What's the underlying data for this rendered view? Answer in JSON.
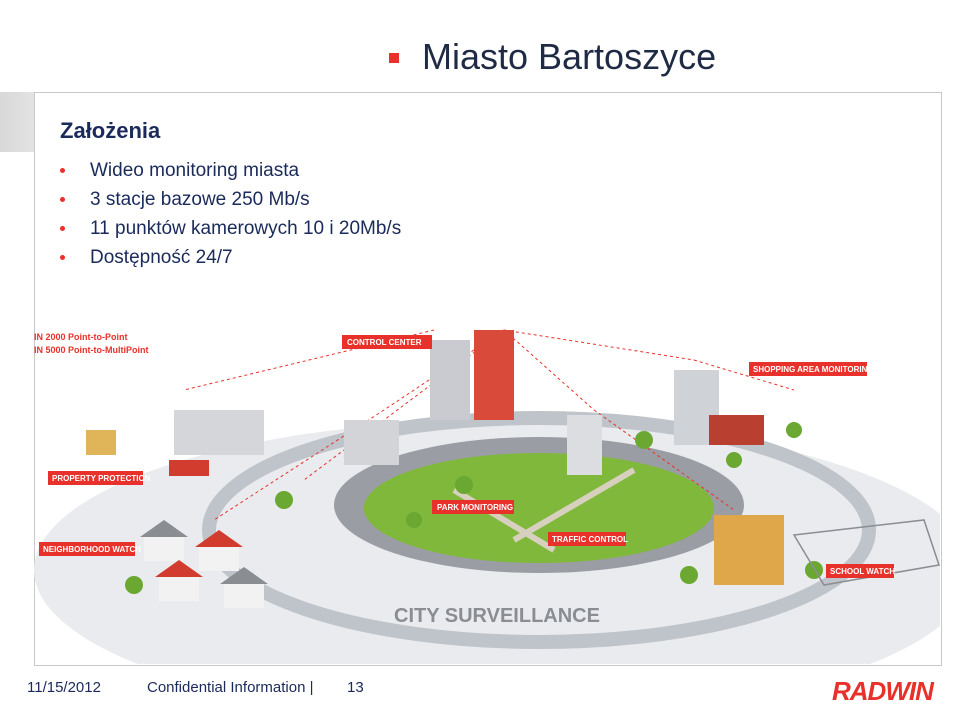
{
  "title": "Miasto Bartoszyce",
  "section": {
    "heading": "Założenia",
    "bullets": [
      "Wideo monitoring miasta",
      "3 stacje bazowe 250 Mb/s",
      "11 punktów kamerowych 10 i 20Mb/s",
      "Dostępność 24/7"
    ]
  },
  "illustration": {
    "legend": [
      "IN 2000 Point-to-Point",
      "IN 5000 Point-to-MultiPoint"
    ],
    "labels": {
      "control_center": "CONTROL CENTER",
      "shopping": "SHOPPING AREA MONITORING",
      "property": "PROPERTY PROTECTION",
      "park": "PARK MONITORING",
      "neighborhood": "NEIGHBORHOOD WATCH",
      "traffic": "TRAFFIC CONTROL",
      "school": "SCHOOL WATCH"
    },
    "caption": "CITY SURVEILLANCE"
  },
  "footer": {
    "date": "11/15/2012",
    "confidential": "Confidential Information  |",
    "page": "13",
    "brand": "RADWIN"
  },
  "colors": {
    "accent": "#e8312a",
    "text": "#1a2a5a"
  }
}
